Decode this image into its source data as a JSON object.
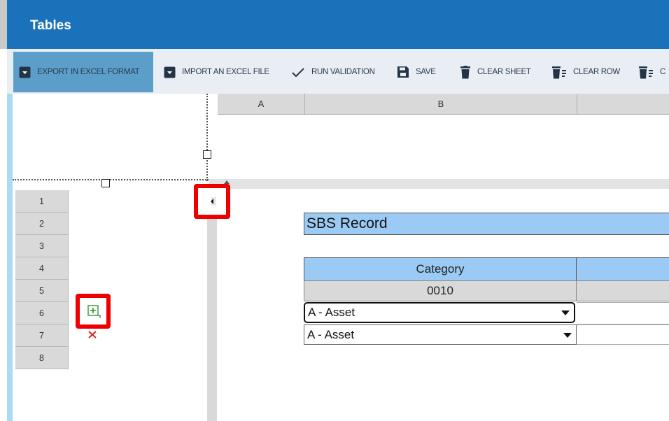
{
  "window": {
    "title": "Tables"
  },
  "toolbar": {
    "export_label": "EXPORT IN EXCEL FORMAT",
    "import_label": "IMPORT AN EXCEL FILE",
    "validate_label": "RUN VALIDATION",
    "save_label": "SAVE",
    "clear_sheet_label": "CLEAR SHEET",
    "clear_row_label": "CLEAR ROW",
    "clear_col_label": "C"
  },
  "grid": {
    "columns": [
      "A",
      "B"
    ],
    "rows": [
      "1",
      "2",
      "3",
      "4",
      "5",
      "6",
      "7",
      "8"
    ]
  },
  "record": {
    "title": "SBS Record",
    "category_header": "Category",
    "category_code": "0010",
    "row1_value": "A - Asset",
    "row2_value": "A - Asset"
  },
  "colors": {
    "titlebar": "#1a72bb",
    "header_fill": "#9bcbf5",
    "highlight": "#ee0000"
  },
  "icons": [
    "export-icon",
    "import-icon",
    "checkmark-icon",
    "save-icon",
    "trash-icon",
    "clear-row-icon",
    "collapse-arrow-icon",
    "add-row-icon",
    "delete-row-icon"
  ]
}
